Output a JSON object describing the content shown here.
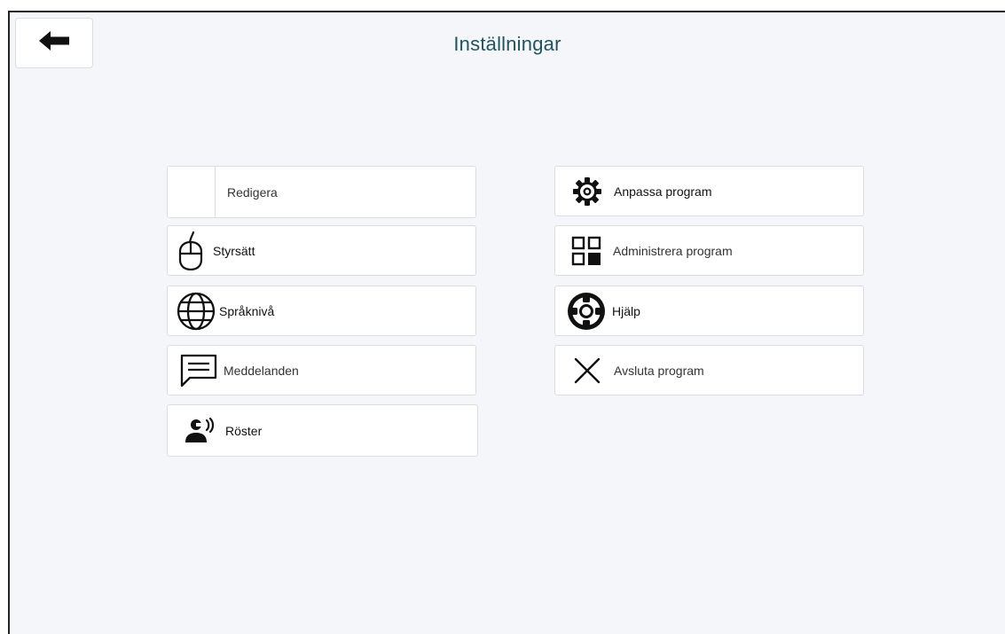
{
  "header": {
    "title": "Inställningar",
    "back_icon": "arrow-left-icon"
  },
  "left_menu": [
    {
      "id": "redigera",
      "label": "Redigera",
      "icon": "none"
    },
    {
      "id": "styrsatt",
      "label": "Styrsätt",
      "icon": "mouse-icon"
    },
    {
      "id": "spraakniva",
      "label": "Språknivå",
      "icon": "globe-icon"
    },
    {
      "id": "meddelanden",
      "label": "Meddelanden",
      "icon": "message-icon"
    },
    {
      "id": "roster",
      "label": "Röster",
      "icon": "speaking-person-icon"
    }
  ],
  "right_menu": [
    {
      "id": "anpassa",
      "label": "Anpassa program",
      "icon": "gear-icon"
    },
    {
      "id": "administrera",
      "label": "Administrera program",
      "icon": "apps-grid-icon"
    },
    {
      "id": "hjalp",
      "label": "Hjälp",
      "icon": "lifebuoy-icon"
    },
    {
      "id": "avsluta",
      "label": "Avsluta program",
      "icon": "close-icon"
    }
  ],
  "colors": {
    "background": "#f5f6fa",
    "title": "#21545c",
    "button_bg": "#ffffff",
    "button_border": "#dcdde2",
    "icon": "#111111"
  }
}
